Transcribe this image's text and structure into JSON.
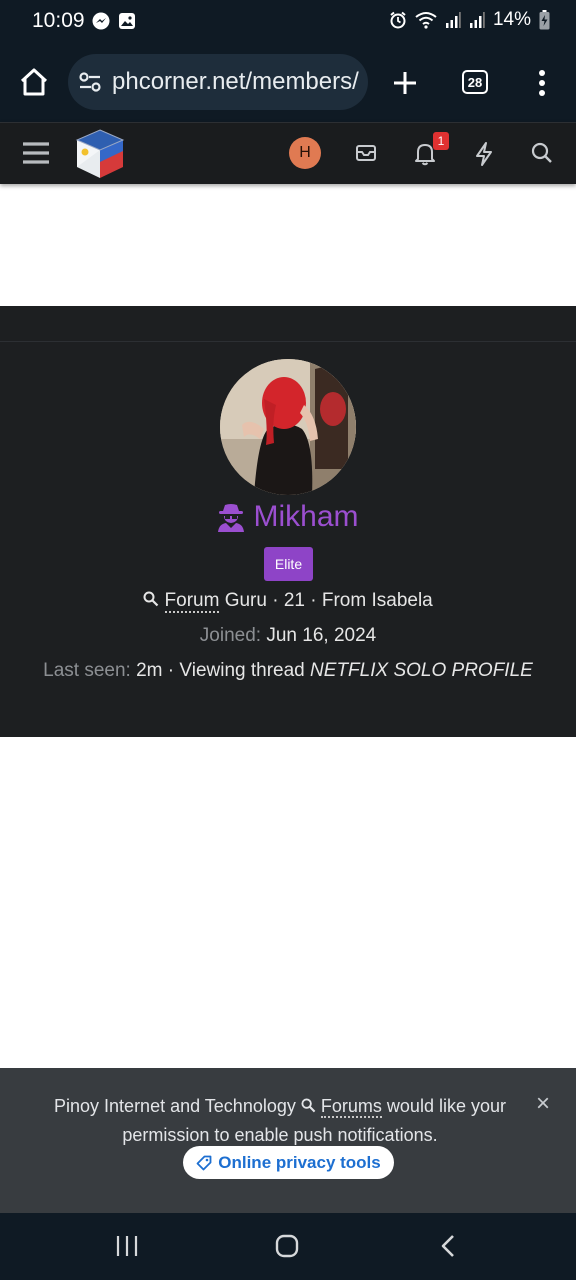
{
  "status_bar": {
    "time": "10:09",
    "battery": "14%"
  },
  "browser": {
    "url": "phcorner.net/members/",
    "tab_count": "28"
  },
  "forum_nav": {
    "user_initial": "H",
    "notification_count": "1"
  },
  "profile": {
    "username": "Mikham",
    "badge": "Elite",
    "title_link": "Forum",
    "title_rest": "Guru",
    "age": "21",
    "location": "From Isabela",
    "joined_label": "Joined:",
    "joined_value": "Jun 16, 2024",
    "last_seen_label": "Last seen:",
    "last_seen_value": "2m",
    "activity_prefix": "Viewing thread",
    "activity_thread": "NETFLIX SOLO PROFILE",
    "separator": "·"
  },
  "push_prompt": {
    "text_before": "Pinoy Internet and Technology",
    "text_link": "Forums",
    "text_after": "would like your permission to enable push notifications.",
    "privacy_button": "Online privacy tools",
    "close": "×"
  },
  "colors": {
    "accent_purple": "#9b4fd0",
    "badge_purple": "#8e44c7",
    "link_blue": "#1d6fd1",
    "notification_red": "#e03131"
  }
}
